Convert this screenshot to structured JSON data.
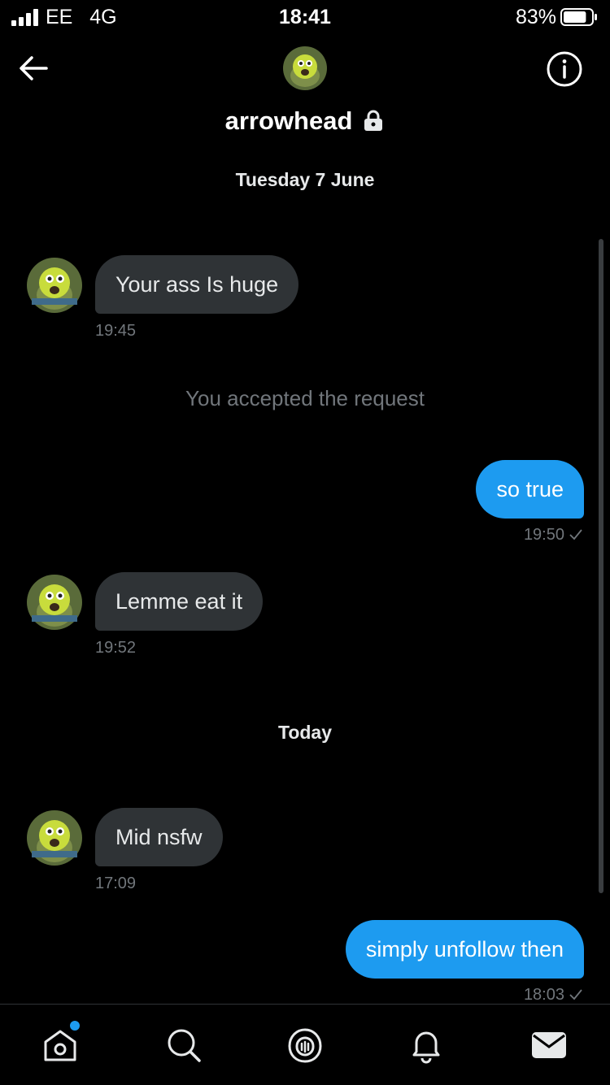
{
  "status_bar": {
    "carrier": "EE",
    "network": "4G",
    "time": "18:41",
    "battery": "83%",
    "battery_level": 0.83
  },
  "header": {
    "name": "arrowhead",
    "avatar_icon": "avatar-image",
    "back_icon": "arrow-left-icon",
    "info_icon": "info-icon",
    "lock_icon": "lock-icon"
  },
  "conversation": {
    "date_1": "Tuesday 7 June",
    "msg_1": {
      "text": "Your ass Is huge",
      "time": "19:45",
      "direction": "in"
    },
    "system": "You accepted the request",
    "msg_2": {
      "text": "so true",
      "time": "19:50",
      "direction": "out"
    },
    "msg_3": {
      "text": "Lemme eat it",
      "time": "19:52",
      "direction": "in"
    },
    "date_2": "Today",
    "msg_4": {
      "text": "Mid nsfw",
      "time": "17:09",
      "direction": "in"
    },
    "msg_5": {
      "text": "simply unfollow then",
      "time": "18:03",
      "direction": "out"
    }
  },
  "tabs": [
    {
      "icon": "home-icon",
      "notification_dot": true
    },
    {
      "icon": "search-icon"
    },
    {
      "icon": "spaces-icon"
    },
    {
      "icon": "bell-icon"
    },
    {
      "icon": "mail-icon",
      "active": true
    }
  ],
  "colors": {
    "background": "#000000",
    "outgoing_bubble": "#1d9bf0",
    "incoming_bubble": "#2f3336",
    "muted_text": "#71767b"
  }
}
